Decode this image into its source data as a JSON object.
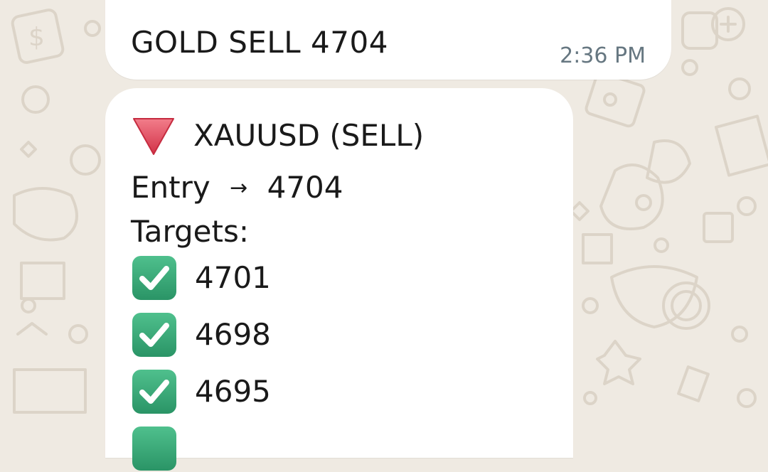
{
  "messages": [
    {
      "text": "GOLD SELL 4704",
      "time": "2:36 PM"
    },
    {
      "title_icon": "red-down-triangle-icon",
      "title": "XAUUSD (SELL)",
      "entry_label": "Entry",
      "entry_arrow": "→",
      "entry_value": "4704",
      "targets_label": "Targets:",
      "targets": [
        {
          "icon": "green-check-box-icon",
          "value": "4701"
        },
        {
          "icon": "green-check-box-icon",
          "value": "4698"
        },
        {
          "icon": "green-check-box-icon",
          "value": "4695"
        }
      ]
    }
  ],
  "colors": {
    "wallpaper": "#efeae2",
    "bubble": "#ffffff",
    "timestamp": "#667781",
    "check_green": "#3aa57a",
    "triangle_red": "#e0495a"
  }
}
